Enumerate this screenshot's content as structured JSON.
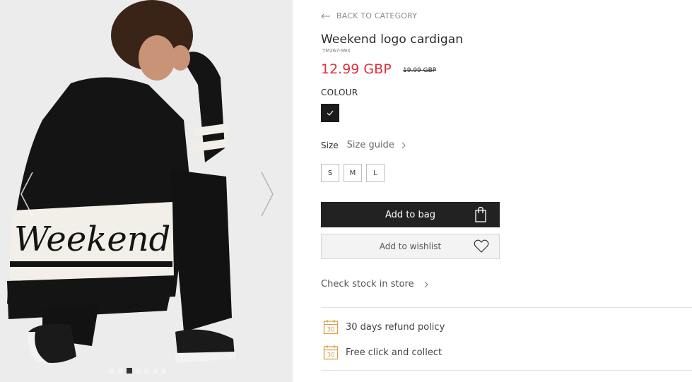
{
  "gallery": {
    "image_alt": "Model wearing black cardigan with Weekend logo",
    "logo_text": "Weekend",
    "dots_count": 7,
    "active_dot": 2
  },
  "product": {
    "back_label": "BACK TO CATEGORY",
    "title": "Weekend logo cardigan",
    "sku": "TM267-99X",
    "price_now": "12.99 GBP",
    "price_old": "19.99 GBP",
    "price_color": "#e0323e",
    "colour_label": "COLOUR",
    "selected_colour": "#1b1b1b",
    "size_label": "Size",
    "size_guide_label": "Size guide",
    "sizes": [
      "S",
      "M",
      "L"
    ],
    "add_to_bag_label": "Add to bag",
    "wishlist_label": "Add to wishlist",
    "check_stock_label": "Check stock in store"
  },
  "features": [
    {
      "icon": "calendar-30-icon",
      "badge": "30",
      "label": "30 days refund policy"
    },
    {
      "icon": "calendar-30-icon",
      "badge": "30",
      "label": "Free click and collect"
    }
  ]
}
